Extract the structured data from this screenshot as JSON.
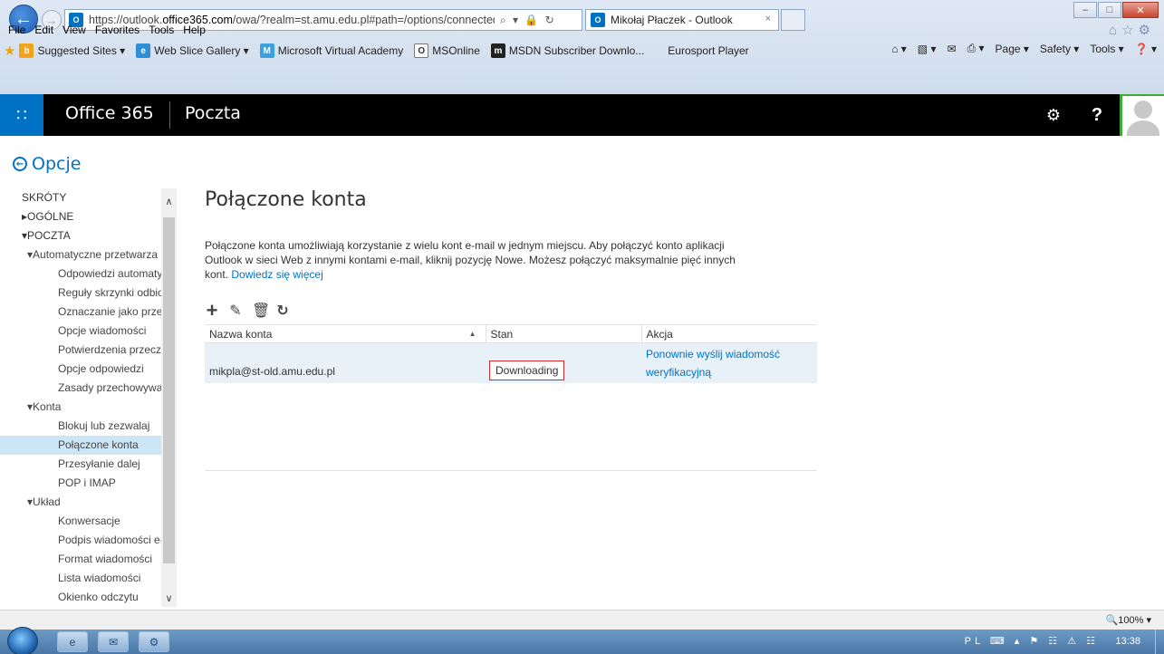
{
  "browser": {
    "url_prefix": "https://outlook.",
    "url_domain": "office365.com",
    "url_rest": "/owa/?realm=st.amu.edu.pl#path=/options/connectedaccounts",
    "address_tools": "⌕ ▾ 🔒 ↻",
    "tab_title": "Mikołaj Płaczek - Outlook",
    "tab_close": "×",
    "tab_icon": "O",
    "back_glyph": "←",
    "forward_glyph": "→",
    "minimize": "–",
    "maximize": "□",
    "close": "✕",
    "ie_icons": "⌂☆⚙"
  },
  "menubar": {
    "items": [
      "File",
      "Edit",
      "View",
      "Favorites",
      "Tools",
      "Help"
    ]
  },
  "favorites": {
    "items": [
      {
        "label": "Suggested Sites ▾",
        "icon": "bing-icon"
      },
      {
        "label": "Web Slice Gallery ▾",
        "icon": "web-slice-icon"
      },
      {
        "label": "Microsoft Virtual Academy",
        "icon": "mva-icon"
      },
      {
        "label": "MSOnline",
        "icon": "msonline-icon"
      },
      {
        "label": "MSDN Subscriber Downlo...",
        "icon": "msdn-icon"
      },
      {
        "label": "Eurosport Player",
        "icon": ""
      }
    ],
    "commands": [
      "⌂ ▾",
      "▧ ▾",
      "✉",
      "⎙ ▾",
      "Page ▾",
      "Safety ▾",
      "Tools ▾",
      "❓ ▾"
    ]
  },
  "suite": {
    "launcher_glyph": "∷",
    "brand": "Office 365",
    "app": "Poczta",
    "settings_glyph": "⚙",
    "help_glyph": "?"
  },
  "options": {
    "back_label": "Opcje",
    "back_glyph": "←"
  },
  "sidebar": {
    "scroll_up": "∧",
    "scroll_down": "∨",
    "items": [
      {
        "label": "SKRÓTY",
        "level": 0
      },
      {
        "label": "▸OGÓLNE",
        "level": 0
      },
      {
        "label": "▾POCZTA",
        "level": 0
      },
      {
        "label": "▾Automatyczne przetwarza",
        "level": 1
      },
      {
        "label": "Odpowiedzi automatyc",
        "level": 2
      },
      {
        "label": "Reguły skrzynki odbiorc",
        "level": 2
      },
      {
        "label": "Oznaczanie jako przecz",
        "level": 2
      },
      {
        "label": "Opcje wiadomości",
        "level": 2
      },
      {
        "label": "Potwierdzenia przeczyta",
        "level": 2
      },
      {
        "label": "Opcje odpowiedzi",
        "level": 2
      },
      {
        "label": "Zasady przechowywania",
        "level": 2
      },
      {
        "label": "▾Konta",
        "level": 1
      },
      {
        "label": "Blokuj lub zezwalaj",
        "level": 2
      },
      {
        "label": "Połączone konta",
        "level": 2,
        "selected": true
      },
      {
        "label": "Przesyłanie dalej",
        "level": 2
      },
      {
        "label": "POP i IMAP",
        "level": 2
      },
      {
        "label": "▾Układ",
        "level": 1
      },
      {
        "label": "Konwersacje",
        "level": 2
      },
      {
        "label": "Podpis wiadomości e-m",
        "level": 2
      },
      {
        "label": "Format wiadomości",
        "level": 2
      },
      {
        "label": "Lista wiadomości",
        "level": 2
      },
      {
        "label": "Okienko odczytu",
        "level": 2
      }
    ]
  },
  "main": {
    "title": "Połączone konta",
    "description": "Połączone konta umożliwiają korzystanie z wielu kont e-mail w jednym miejscu. Aby połączyć konto aplikacji Outlook w sieci Web z innymi kontami e-mail, kliknij pozycję Nowe. Możesz połączyć maksymalnie pięć innych kont.",
    "learn_more": "Dowiedz się więcej",
    "toolbar": {
      "add": "+",
      "edit": "✎",
      "delete": "🗑",
      "refresh": "↻"
    },
    "table": {
      "columns": [
        "Nazwa konta",
        "Stan",
        "Akcja"
      ],
      "sort_indicator": "▲",
      "rows": [
        {
          "account": "mikpla@st-old.amu.edu.pl",
          "status": "Downloading",
          "action": "Ponownie wyślij wiadomość weryfikacyjną"
        }
      ]
    }
  },
  "statusbar": {
    "zoom": "🔍100% ▾"
  },
  "taskbar": {
    "tray": "PL ⌨ ▴ ⚑ ☷ ⚠ ☷",
    "clock": "13:38",
    "apps": [
      "e",
      "✉",
      "⚙"
    ]
  }
}
